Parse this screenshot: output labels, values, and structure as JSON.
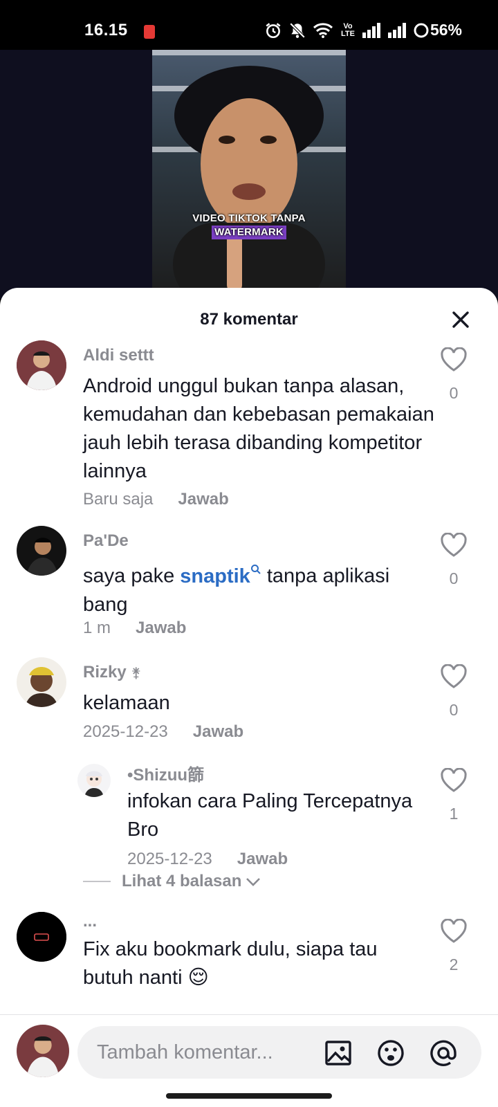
{
  "status_bar": {
    "time": "16.15",
    "network": "Vo LTE",
    "battery": "56%"
  },
  "video": {
    "caption_line1": "VIDEO TIKTOK TANPA",
    "caption_line2": "WATERMARK"
  },
  "sheet": {
    "title": "87 komentar"
  },
  "comments": [
    {
      "username": "Aldi settt",
      "text": "Android unggul bukan tanpa alasan, kemudahan dan kebebasan pemakaian jauh lebih terasa dibanding kompetitor lainnya",
      "time": "Baru saja",
      "reply_label": "Jawab",
      "likes": "0"
    },
    {
      "username": "Pa'De",
      "text_before": "saya pake ",
      "link": "snaptik",
      "text_after": " tanpa aplikasi bang",
      "time": "1 m",
      "reply_label": "Jawab",
      "likes": "0"
    },
    {
      "username": "Rizky",
      "username_symbol": "⚵",
      "text": "kelamaan",
      "time": "2025-12-23",
      "reply_label": "Jawab",
      "likes": "0",
      "replies": [
        {
          "username": "•Shizuu篩",
          "text": "infokan cara Paling Tercepatnya Bro",
          "time": "2025-12-23",
          "reply_label": "Jawab",
          "likes": "1"
        }
      ],
      "view_replies_label": "Lihat 4 balasan"
    },
    {
      "username": "...",
      "text": "Fix aku bookmark dulu, siapa tau butuh nanti 😌",
      "likes": "2"
    }
  ],
  "input": {
    "placeholder": "Tambah komentar..."
  },
  "icons": {
    "close": "close-icon",
    "like": "heart-icon",
    "image": "image-icon",
    "emoji": "emoji-icon",
    "mention": "at-icon",
    "chevron": "chevron-down-icon"
  },
  "colors": {
    "link": "#2b6cc4",
    "muted": "#8a8b91",
    "text": "#161823",
    "caption_highlight": "#7a3fc2"
  }
}
